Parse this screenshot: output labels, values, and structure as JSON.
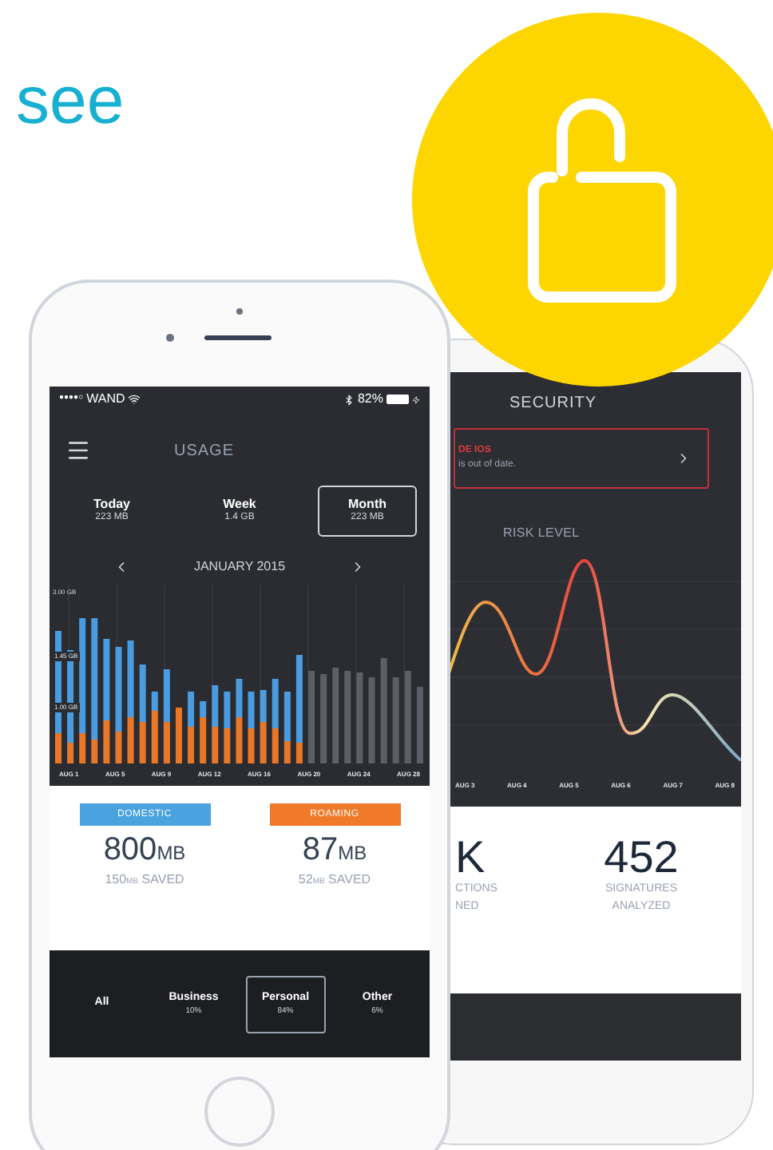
{
  "headline": "see",
  "usage_phone": {
    "status_bar": {
      "signal": "●●●●○",
      "carrier": "WAND",
      "battery": "82%"
    },
    "title": "USAGE",
    "periods": [
      {
        "label": "Today",
        "value": "223 MB",
        "selected": false
      },
      {
        "label": "Week",
        "value": "1.4 GB",
        "selected": false
      },
      {
        "label": "Month",
        "value": "223 MB",
        "selected": true
      }
    ],
    "month": "JANUARY 2015",
    "chart": {
      "y_labels": [
        "3.00 GB",
        "1.45 GB",
        "1.00 GB"
      ],
      "x_labels": [
        "AUG 1",
        "AUG 5",
        "AUG 9",
        "AUG 12",
        "AUG 16",
        "AUG 20",
        "AUG 24",
        "AUG 28"
      ]
    },
    "summary": [
      {
        "tag": "DOMESTIC",
        "color": "#4aa3df",
        "value": "800",
        "unit": "MB",
        "saved_amount": "150",
        "saved_unit": "MB",
        "saved_label": "SAVED"
      },
      {
        "tag": "ROAMING",
        "color": "#f07a2a",
        "value": "87",
        "unit": "MB",
        "saved_amount": "52",
        "saved_unit": "MB",
        "saved_label": "SAVED"
      }
    ],
    "categories": [
      {
        "label": "All",
        "selected": false
      },
      {
        "label": "Business",
        "share": "10%",
        "selected": false
      },
      {
        "label": "Personal",
        "share": "84%",
        "selected": true
      },
      {
        "label": "Other",
        "share": "6%",
        "selected": false
      }
    ]
  },
  "security_phone": {
    "title": "SECURITY",
    "alert": {
      "title": "DE IOS",
      "message": "is out of date."
    },
    "section": "RISK LEVEL",
    "x_labels": [
      "AUG 3",
      "AUG 4",
      "AUG 5",
      "AUG 6",
      "AUG 7",
      "AUG 8"
    ],
    "stats": [
      {
        "value": "K",
        "label_lines": [
          "CTIONS",
          "NED"
        ]
      },
      {
        "value": "452",
        "label_lines": [
          "SIGNATURES",
          "ANALYZED"
        ]
      }
    ]
  }
}
